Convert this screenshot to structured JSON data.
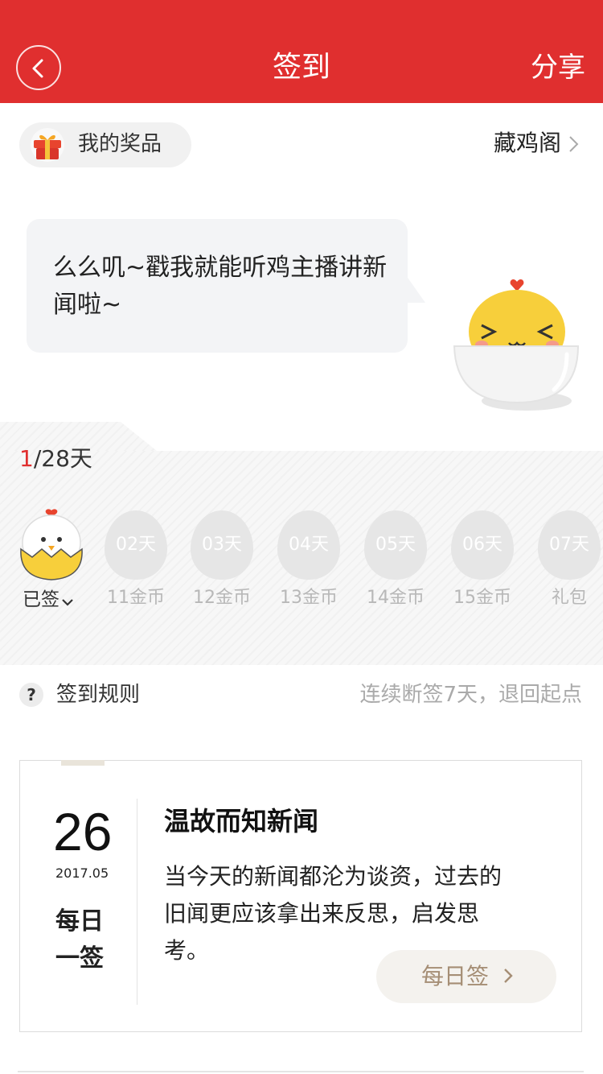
{
  "header": {
    "title": "签到",
    "share_label": "分享",
    "back_icon": "chevron-left-icon",
    "color": "#e02f2f"
  },
  "prizes": {
    "label": "我的奖品",
    "icon": "gift-icon",
    "link_label": "藏鸡阁"
  },
  "bubble": {
    "text": "么么叽~戳我就能听鸡主播讲新闻啦~"
  },
  "progress": {
    "current": "1",
    "total_text": "/28天"
  },
  "days": [
    {
      "state": "signed",
      "label": "已签",
      "icon": "hen-icon"
    },
    {
      "day": "02天",
      "reward": "11金币"
    },
    {
      "day": "03天",
      "reward": "12金币"
    },
    {
      "day": "04天",
      "reward": "13金币"
    },
    {
      "day": "05天",
      "reward": "14金币"
    },
    {
      "day": "06天",
      "reward": "15金币"
    },
    {
      "day": "07天",
      "reward": "礼包"
    }
  ],
  "rules": {
    "icon_glyph": "?",
    "label": "签到规则",
    "note": "连续断签7天，退回起点"
  },
  "daily_card": {
    "day": "26",
    "year_month": "2017.05",
    "label": "每日一签",
    "heading": "温故而知新闻",
    "body": "当今天的新闻都沦为谈资，过去的旧闻更应该拿出来反思，启发思考。",
    "button_label": "每日签"
  }
}
